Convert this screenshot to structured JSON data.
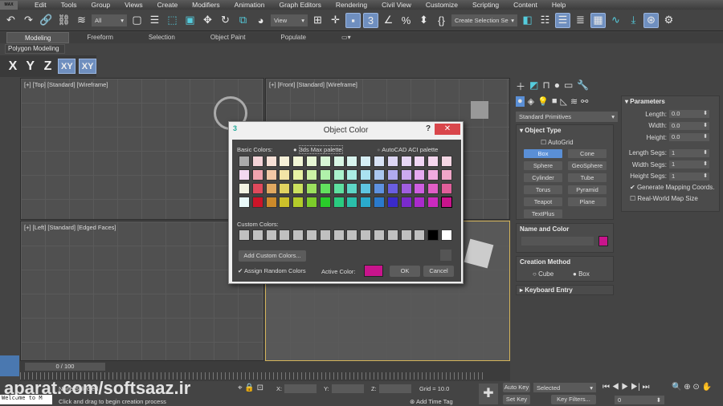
{
  "menu": {
    "logo": "MAX",
    "items": [
      "Edit",
      "Tools",
      "Group",
      "Views",
      "Create",
      "Modifiers",
      "Animation",
      "Graph Editors",
      "Rendering",
      "Civil View",
      "Customize",
      "Scripting",
      "Content",
      "Help"
    ]
  },
  "toolbar": {
    "filter_value": "All",
    "ref_coord_value": "View",
    "selection_set_placeholder": "Create Selection Se"
  },
  "ribbon": {
    "tabs": [
      "Modeling",
      "Freeform",
      "Selection",
      "Object Paint",
      "Populate"
    ],
    "active": "Modeling",
    "panel_label": "Polygon Modeling"
  },
  "axis": {
    "buttons": [
      "X",
      "Y",
      "Z",
      "XY",
      "XY"
    ]
  },
  "viewports": {
    "top": "[+] [Top] [Standard] [Wireframe]",
    "front": "[+] [Front] [Standard] [Wireframe]",
    "left": "[+] [Left] [Standard] [Edged Faces]",
    "persp": ""
  },
  "dialog": {
    "title": "Object Color",
    "help": "?",
    "close": "✕",
    "basic_colors_label": "Basic Colors:",
    "palette_options": [
      "3ds Max palette",
      "AutoCAD ACI palette"
    ],
    "palette_selected": "3ds Max palette",
    "basic_colors": [
      [
        "#aaaaaa",
        "#f4d4d8",
        "#f6e0d6",
        "#f6f0d8",
        "#f2f6d6",
        "#e6f6d4",
        "#d8f6d6",
        "#d8f6e4",
        "#d8f4ee",
        "#d6eef4",
        "#d8e2f4",
        "#ddd6f4",
        "#e6d6f4",
        "#f0d6f4",
        "#f4d6ee",
        "#f4d6e4"
      ],
      [
        "#f2d8f0",
        "#f0a4ae",
        "#f2c8a6",
        "#f2e4a6",
        "#e8f2a4",
        "#ccf2a6",
        "#b0f2aa",
        "#aaf2cc",
        "#aaeee4",
        "#aae2f0",
        "#aac6f0",
        "#b0aaf0",
        "#ccaaf0",
        "#e6aaf0",
        "#f0aae0",
        "#f0a6c8"
      ],
      [
        "#f2f2e2",
        "#e04a5c",
        "#e0a860",
        "#e0d260",
        "#cce05e",
        "#9ce05e",
        "#62e05e",
        "#5ee0a0",
        "#5ed6c6",
        "#5ec4e0",
        "#5e92e0",
        "#6a5ee0",
        "#a05ee0",
        "#ce5ee0",
        "#e05ec6",
        "#e05e9a"
      ],
      [
        "#e8f8f8",
        "#cc1428",
        "#cc8a2a",
        "#ccc02a",
        "#b4cc2a",
        "#7ccc2a",
        "#2acc2a",
        "#2acc80",
        "#2abfaa",
        "#2aaacc",
        "#2a7acc",
        "#3a2acc",
        "#7a2acc",
        "#aa2acc",
        "#cc2abf",
        "#c8148c"
      ]
    ],
    "custom_colors_label": "Custom Colors:",
    "custom_colors": [
      "#c0c0c0",
      "#c0c0c0",
      "#c0c0c0",
      "#c0c0c0",
      "#c0c0c0",
      "#c0c0c0",
      "#c0c0c0",
      "#c0c0c0",
      "#c0c0c0",
      "#c0c0c0",
      "#c0c0c0",
      "#c0c0c0",
      "#c0c0c0",
      "#c0c0c0",
      "#000000",
      "#ffffff"
    ],
    "add_custom": "Add Custom Colors...",
    "assign_random": "Assign Random Colors",
    "assign_random_checked": true,
    "active_color_label": "Active Color:",
    "active_color": "#c8148c",
    "ok": "OK",
    "cancel": "Cancel"
  },
  "command_panel": {
    "category": "Standard Primitives",
    "object_type": {
      "title": "Object Type",
      "autogrid": "AutoGrid",
      "buttons": [
        "Box",
        "Cone",
        "Sphere",
        "GeoSphere",
        "Cylinder",
        "Tube",
        "Torus",
        "Pyramid",
        "Teapot",
        "Plane",
        "TextPlus"
      ],
      "active": "Box"
    },
    "name_color": {
      "title": "Name and Color",
      "name": "",
      "color": "#c8148c"
    },
    "creation_method": {
      "title": "Creation Method",
      "options": [
        "Cube",
        "Box"
      ],
      "selected": "Box"
    },
    "keyboard_entry": {
      "title": "Keyboard Entry"
    },
    "parameters": {
      "title": "Parameters",
      "fields": [
        {
          "label": "Length:",
          "value": "0.0"
        },
        {
          "label": "Width:",
          "value": "0.0"
        },
        {
          "label": "Height:",
          "value": "0.0"
        },
        {
          "label": "Length Segs:",
          "value": "1"
        },
        {
          "label": "Width Segs:",
          "value": "1"
        },
        {
          "label": "Height Segs:",
          "value": "1"
        }
      ],
      "gen_mapping": "Generate Mapping Coords.",
      "real_world": "Real-World Map Size"
    }
  },
  "timeline": {
    "frame": "0 / 100"
  },
  "status": {
    "script_listener": "Welcome to M",
    "selection": "None Selected",
    "prompt": "Click and drag to begin creation process",
    "x_label": "X:",
    "y_label": "Y:",
    "z_label": "Z:",
    "grid": "Grid = 10.0",
    "add_time_tag": "Add Time Tag",
    "auto_key": "Auto Key",
    "set_key": "Set Key",
    "key_mode": "Selected",
    "key_filters": "Key Filters...",
    "current_frame": "0",
    "watermark": "aparat.com/softsaaz.ir"
  }
}
